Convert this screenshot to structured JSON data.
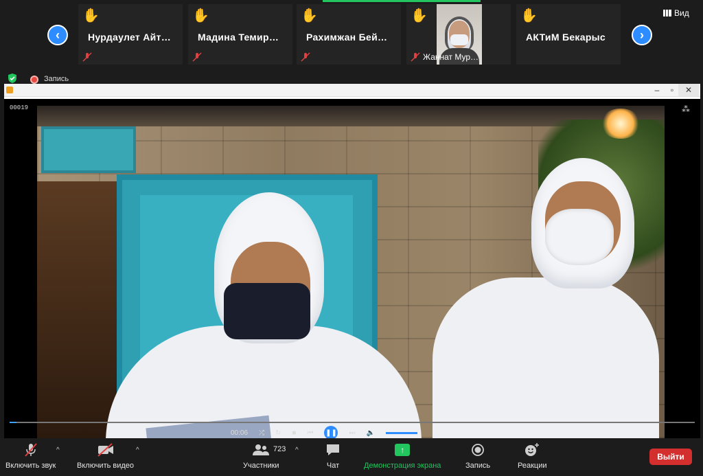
{
  "participants": [
    {
      "name": "Нурдаулет  Айт…",
      "hand": "✋"
    },
    {
      "name": "Мадина  Темир…",
      "hand": "✋"
    },
    {
      "name": "Рахимжан  Бей…",
      "hand": "✋"
    },
    {
      "name": "Жаннат Мур…",
      "hand": "✋",
      "video": true
    },
    {
      "name": "АКТиМ Бекарыс",
      "hand": "✋"
    }
  ],
  "view_label": "Вид",
  "recording_label": "Запись",
  "player": {
    "frame_counter": "00019",
    "time": "00:06",
    "progress_fraction": 0.01
  },
  "toolbar": {
    "audio_label": "Включить звук",
    "video_label": "Включить видео",
    "participants_label": "Участники",
    "participants_count": "723",
    "chat_label": "Чат",
    "share_label": "Демонстрация экрана",
    "record_label": "Запись",
    "reactions_label": "Реакции",
    "leave_label": "Выйти"
  },
  "colors": {
    "accent": "#2d8cff",
    "share_green": "#22c55e",
    "leave_red": "#d32f2f"
  }
}
